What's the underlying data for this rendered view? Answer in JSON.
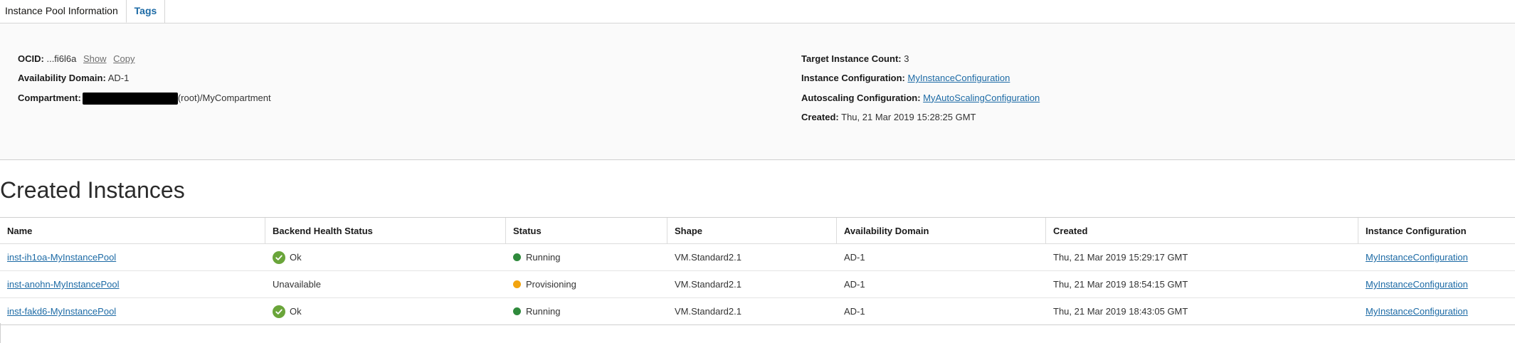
{
  "tabs": [
    {
      "label": "Instance Pool Information",
      "active": true
    },
    {
      "label": "Tags",
      "active": false
    }
  ],
  "info": {
    "ocid_label": "OCID:",
    "ocid_value": "...fi6l6a",
    "show_label": "Show",
    "copy_label": "Copy",
    "ad_label": "Availability Domain:",
    "ad_value": "AD-1",
    "compartment_label": "Compartment:",
    "compartment_value": "(root)/MyCompartment",
    "target_count_label": "Target Instance Count:",
    "target_count_value": "3",
    "instance_config_label": "Instance Configuration:",
    "instance_config_value": "MyInstanceConfiguration",
    "autoscaling_label": "Autoscaling Configuration:",
    "autoscaling_value": "MyAutoScalingConfiguration",
    "created_label": "Created:",
    "created_value": "Thu, 21 Mar 2019 15:28:25 GMT"
  },
  "section_title": "Created Instances",
  "table": {
    "headers": [
      "Name",
      "Backend Health Status",
      "Status",
      "Shape",
      "Availability Domain",
      "Created",
      "Instance Configuration"
    ],
    "rows": [
      {
        "name": "inst-ih1oa-MyInstancePool",
        "health": "Ok",
        "health_ok": true,
        "status": "Running",
        "status_color": "#2f8a3c",
        "shape": "VM.Standard2.1",
        "ad": "AD-1",
        "created": "Thu, 21 Mar 2019 15:29:17 GMT",
        "config": "MyInstanceConfiguration"
      },
      {
        "name": "inst-anohn-MyInstancePool",
        "health": "Unavailable",
        "health_ok": false,
        "status": "Provisioning",
        "status_color": "#f2a40f",
        "shape": "VM.Standard2.1",
        "ad": "AD-1",
        "created": "Thu, 21 Mar 2019 18:54:15 GMT",
        "config": "MyInstanceConfiguration"
      },
      {
        "name": "inst-fakd6-MyInstancePool",
        "health": "Ok",
        "health_ok": true,
        "status": "Running",
        "status_color": "#2f8a3c",
        "shape": "VM.Standard2.1",
        "ad": "AD-1",
        "created": "Thu, 21 Mar 2019 18:43:05 GMT",
        "config": "MyInstanceConfiguration"
      }
    ]
  },
  "colors": {
    "link": "#1c6aa5",
    "ok": "#6aa53a",
    "running": "#2f8a3c",
    "provisioning": "#f2a40f"
  },
  "icons": {
    "ok": "check-circle-icon",
    "status": "status-dot-icon"
  }
}
